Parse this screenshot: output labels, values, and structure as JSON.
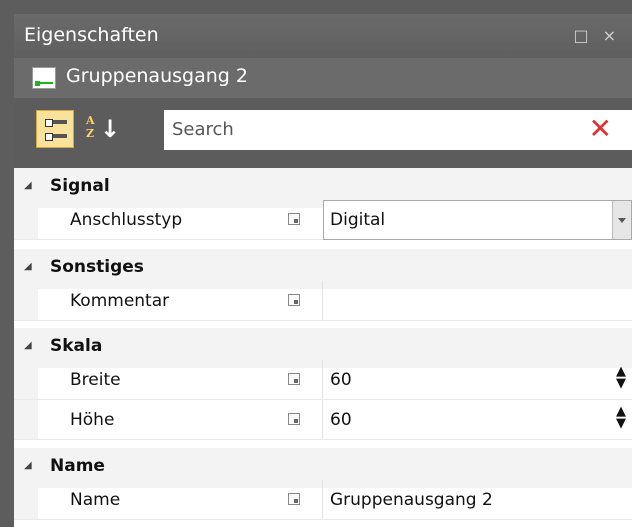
{
  "window": {
    "title": "Eigenschaften",
    "buttons": [
      "□",
      "×"
    ]
  },
  "object": {
    "name": "Gruppenausgang 2",
    "icon": "output-connector-icon"
  },
  "toolbar": {
    "categorized_icon": "categorized-view-icon",
    "alphabetical_icon": "sort-az-icon",
    "search_placeholder": "Search",
    "clear_icon": "clear-search-icon",
    "az_text": "A\nZ",
    "arrow": "↓",
    "clear_glyph": "✕"
  },
  "grid": {
    "categories": [
      {
        "label": "Signal",
        "properties": [
          {
            "label": "Anschlusstyp",
            "value": "Digital",
            "editor": "dropdown"
          }
        ]
      },
      {
        "label": "Sonstiges",
        "properties": [
          {
            "label": "Kommentar",
            "value": "",
            "editor": "text"
          }
        ]
      },
      {
        "label": "Skala",
        "properties": [
          {
            "label": "Breite",
            "value": "60",
            "editor": "spinner"
          },
          {
            "label": "Höhe",
            "value": "60",
            "editor": "spinner"
          }
        ]
      },
      {
        "label": "Name",
        "properties": [
          {
            "label": "Name",
            "value": "Gruppenausgang 2",
            "editor": "text"
          }
        ]
      }
    ],
    "expand_glyph": "◢",
    "spin_glyph": "▲\n▼"
  }
}
